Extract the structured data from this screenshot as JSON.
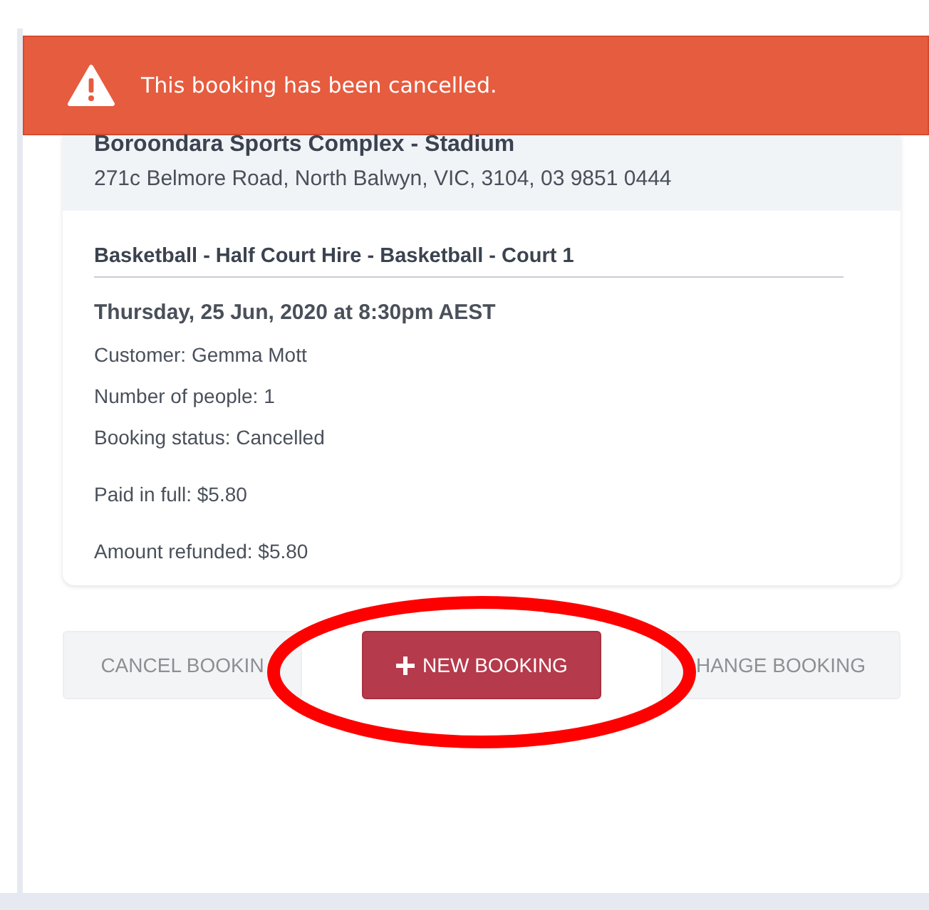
{
  "alert": {
    "kind": "error",
    "message": "This booking has been cancelled."
  },
  "venue": {
    "name": "Boroondara Sports Complex - Stadium",
    "address": "271c Belmore Road, North Balwyn, VIC, 3104, 03 9851 0444"
  },
  "booking": {
    "title": "Basketball - Half Court Hire - Basketball - Court 1",
    "datetime": "Thursday, 25 Jun, 2020 at 8:30pm AEST",
    "details": [
      "Customer: Gemma Mott",
      "Number of people: 1",
      "Booking status: Cancelled"
    ],
    "payments": [
      "Paid in full: $5.80",
      "Amount refunded: $5.80"
    ]
  },
  "buttons": [
    {
      "label": "CANCEL BOOKIN",
      "kind": "secondary"
    },
    {
      "label": "NEW BOOKING",
      "kind": "primary"
    },
    {
      "label": "HANGE BOOKING",
      "kind": "secondary"
    }
  ]
}
